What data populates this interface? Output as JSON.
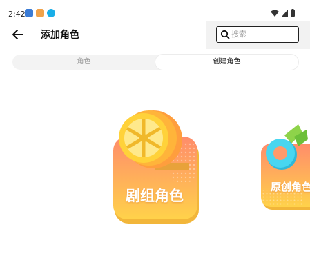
{
  "status_bar": {
    "time": "2:42",
    "app_icons": [
      "mail-icon",
      "game-icon",
      "download-icon"
    ],
    "right_icons": [
      "wifi-icon",
      "signal-icon",
      "battery-icon"
    ]
  },
  "header": {
    "title": "添加角色",
    "back_icon": "arrow-left-icon"
  },
  "search": {
    "placeholder": "搜索",
    "value": "",
    "icon": "search-icon"
  },
  "tabs": [
    {
      "label": "角色",
      "selected": false
    },
    {
      "label": "创建角色",
      "selected": true
    }
  ],
  "cards": [
    {
      "label": "剧组角色",
      "icon": "film-reel-icon"
    },
    {
      "label": "原创角色",
      "icon": "ring-icon"
    }
  ],
  "colors": {
    "card_gradient_top": "#ff8c6b",
    "card_gradient_bottom": "#ffd24a",
    "reel_yellow": "#ffd23a",
    "ring_cyan": "#48d6f0",
    "leaf_green": "#8ed34a"
  }
}
